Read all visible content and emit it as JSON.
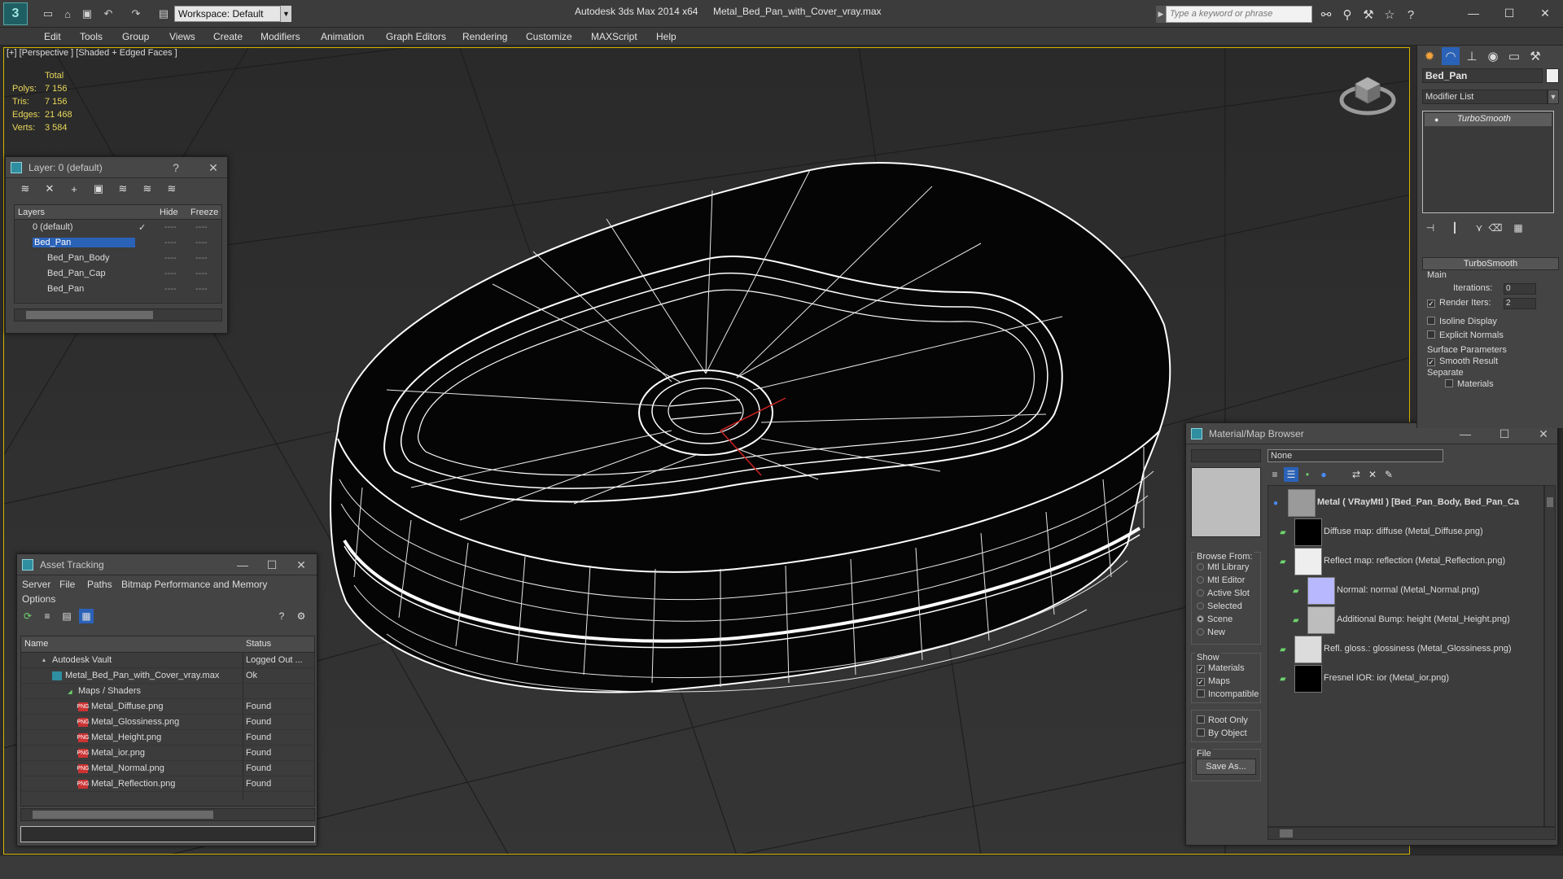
{
  "titlebar": {
    "workspace": "Workspace: Default",
    "app_title": "Autodesk 3ds Max  2014 x64",
    "file_title": "Metal_Bed_Pan_with_Cover_vray.max",
    "search_placeholder": "Type a keyword or phrase"
  },
  "menu": [
    "Edit",
    "Tools",
    "Group",
    "Views",
    "Create",
    "Modifiers",
    "Animation",
    "Graph Editors",
    "Rendering",
    "Customize",
    "MAXScript",
    "Help"
  ],
  "viewport": {
    "label": "[+] [Perspective ] [Shaded + Edged Faces ]",
    "stats": {
      "header": "Total",
      "rows": [
        {
          "label": "Polys:",
          "value": "7 156"
        },
        {
          "label": "Tris:",
          "value": "7 156"
        },
        {
          "label": "Edges:",
          "value": "21 468"
        },
        {
          "label": "Verts:",
          "value": "3 584"
        }
      ]
    }
  },
  "layer_window": {
    "title": "Layer: 0 (default)",
    "help": "?",
    "columns": [
      "Layers",
      "Hide",
      "Freeze"
    ],
    "rows": [
      {
        "name": "0 (default)",
        "check": "✓"
      },
      {
        "name": "Bed_Pan",
        "selected": true
      },
      {
        "name": "Bed_Pan_Body"
      },
      {
        "name": "Bed_Pan_Cap"
      },
      {
        "name": "Bed_Pan"
      }
    ],
    "dash": "----"
  },
  "asset_window": {
    "title": "Asset Tracking",
    "menu": [
      "Server",
      "File",
      "Paths",
      "Bitmap Performance and Memory",
      "Options"
    ],
    "columns": [
      "Name",
      "Status"
    ],
    "rows": [
      {
        "name": "Autodesk Vault",
        "status": "Logged Out ..."
      },
      {
        "name": "Metal_Bed_Pan_with_Cover_vray.max",
        "status": "Ok"
      },
      {
        "name": "Maps / Shaders",
        "status": ""
      },
      {
        "name": "Metal_Diffuse.png",
        "status": "Found"
      },
      {
        "name": "Metal_Glossiness.png",
        "status": "Found"
      },
      {
        "name": "Metal_Height.png",
        "status": "Found"
      },
      {
        "name": "Metal_ior.png",
        "status": "Found"
      },
      {
        "name": "Metal_Normal.png",
        "status": "Found"
      },
      {
        "name": "Metal_Reflection.png",
        "status": "Found"
      }
    ]
  },
  "material_browser": {
    "title": "Material/Map Browser",
    "search_value": "None",
    "browse_from": {
      "title": "Browse From:",
      "options": [
        "Mtl Library",
        "Mtl Editor",
        "Active Slot",
        "Selected",
        "Scene",
        "New"
      ],
      "selected": "Scene"
    },
    "show": {
      "title": "Show",
      "options": [
        {
          "label": "Materials",
          "checked": true
        },
        {
          "label": "Maps",
          "checked": true
        },
        {
          "label": "Incompatible",
          "checked": false
        }
      ]
    },
    "extra": [
      {
        "label": "Root Only",
        "checked": false
      },
      {
        "label": "By Object",
        "checked": false
      }
    ],
    "file": {
      "title": "File",
      "save_as": "Save As..."
    },
    "tree": [
      {
        "label": "Metal  ( VRayMtl ) [Bed_Pan_Body, Bed_Pan_Ca",
        "swatch": "#9a9a9a",
        "indent": 0
      },
      {
        "label": "Diffuse map: diffuse (Metal_Diffuse.png)",
        "swatch": "#000000",
        "indent": 1
      },
      {
        "label": "Reflect map: reflection (Metal_Reflection.png)",
        "swatch": "#eeeeee",
        "indent": 1
      },
      {
        "label": "Normal: normal (Metal_Normal.png)",
        "swatch": "#b8b8ff",
        "indent": 2
      },
      {
        "label": "Additional Bump: height (Metal_Height.png)",
        "swatch": "#bdbdbd",
        "indent": 2
      },
      {
        "label": "Refl. gloss.: glossiness (Metal_Glossiness.png)",
        "swatch": "#dcdcdc",
        "indent": 1
      },
      {
        "label": "Fresnel IOR: ior (Metal_ior.png)",
        "swatch": "#000000",
        "indent": 1
      }
    ]
  },
  "command_panel": {
    "object_name": "Bed_Pan",
    "modifier_list": "Modifier List",
    "stack_item": "TurboSmooth",
    "rollout": "TurboSmooth",
    "main": "Main",
    "iterations_label": "Iterations:",
    "iterations_value": "0",
    "render_iters_label": "Render Iters:",
    "render_iters_value": "2",
    "isoline": "Isoline Display",
    "explicit_normals": "Explicit Normals",
    "surface_params": "Surface Parameters",
    "smooth_result": "Smooth Result",
    "separate": "Separate",
    "materials": "Materials"
  },
  "colors": {
    "accent": "#d4b400",
    "selection": "#2a62b8",
    "wire": "#ffffff"
  }
}
